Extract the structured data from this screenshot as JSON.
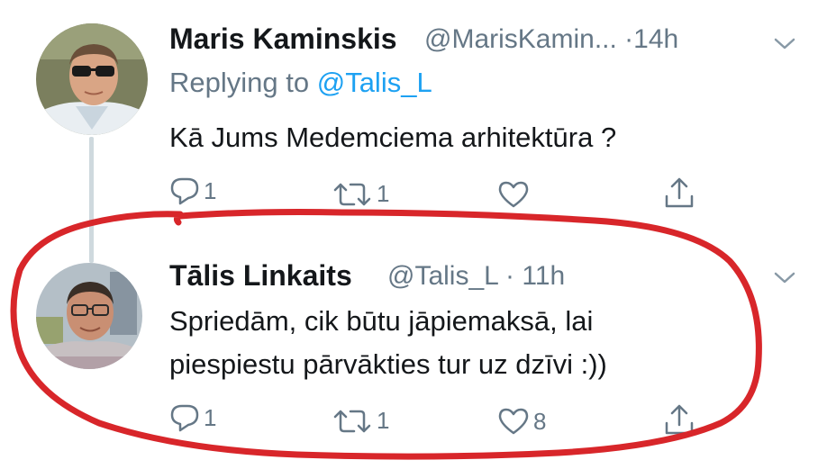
{
  "tweets": [
    {
      "author_name": "Maris Kaminskis",
      "handle_and_time": "@MarisKamin... ·14h",
      "replying_prefix": "Replying to ",
      "replying_handle": "@Talis_L",
      "text": "Kā Jums Medemciema arhitektūra ?",
      "reply_count": "1",
      "retweet_count": "1",
      "like_count": "",
      "avatar_icon": "person-with-sunglasses-avatar"
    },
    {
      "author_name": "Tālis Linkaits",
      "handle_and_time": "@Talis_L · 11h",
      "text_line_1": "Spriedām, cik būtu jāpiemaksā, lai",
      "text_line_2": "piespiestu pārvākties tur uz dzīvi :))",
      "reply_count": "1",
      "retweet_count": "1",
      "like_count": "8",
      "avatar_icon": "person-with-glasses-avatar"
    }
  ],
  "colors": {
    "text_primary": "#14171a",
    "text_secondary": "#657786",
    "link": "#1da1f2",
    "thread_line": "#cfd9de",
    "annotation_ink": "#d8262a"
  },
  "icons": [
    "reply-icon",
    "retweet-icon",
    "like-icon",
    "share-icon",
    "chevron-down-icon"
  ]
}
